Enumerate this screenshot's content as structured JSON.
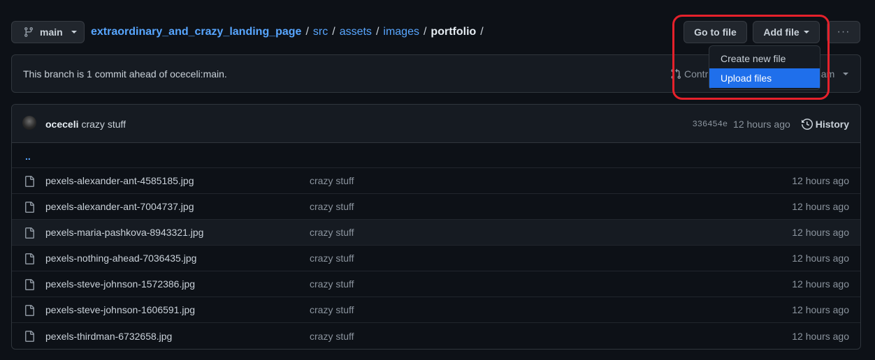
{
  "branch": {
    "name": "main",
    "icon": "git-branch-icon"
  },
  "breadcrumb": {
    "repo": "extraordinary_and_crazy_landing_page",
    "parts": [
      "src",
      "assets",
      "images"
    ],
    "current": "portfolio",
    "sep": "/"
  },
  "actions": {
    "goto_file": "Go to file",
    "add_file": "Add file",
    "more": "···"
  },
  "dropdown": {
    "items": [
      "Create new file",
      "Upload files"
    ],
    "selected": "Upload files"
  },
  "ahead_bar": {
    "text": "This branch is 1 commit ahead of oceceli:main.",
    "contribute_partial": "Contr",
    "fetch_partial": "eam"
  },
  "latest_commit": {
    "author": "oceceli",
    "message": "crazy stuff",
    "sha": "336454e",
    "age": "12 hours ago",
    "history_label": "History"
  },
  "files": {
    "parent": "..",
    "rows": [
      {
        "name": "pexels-alexander-ant-4585185.jpg",
        "message": "crazy stuff",
        "age": "12 hours ago"
      },
      {
        "name": "pexels-alexander-ant-7004737.jpg",
        "message": "crazy stuff",
        "age": "12 hours ago"
      },
      {
        "name": "pexels-maria-pashkova-8943321.jpg",
        "message": "crazy stuff",
        "age": "12 hours ago"
      },
      {
        "name": "pexels-nothing-ahead-7036435.jpg",
        "message": "crazy stuff",
        "age": "12 hours ago"
      },
      {
        "name": "pexels-steve-johnson-1572386.jpg",
        "message": "crazy stuff",
        "age": "12 hours ago"
      },
      {
        "name": "pexels-steve-johnson-1606591.jpg",
        "message": "crazy stuff",
        "age": "12 hours ago"
      },
      {
        "name": "pexels-thirdman-6732658.jpg",
        "message": "crazy stuff",
        "age": "12 hours ago"
      }
    ]
  },
  "colors": {
    "background": "#0d1117",
    "link": "#58a6ff",
    "selected_item": "#1f6feb",
    "highlight_box": "#e5212b"
  }
}
